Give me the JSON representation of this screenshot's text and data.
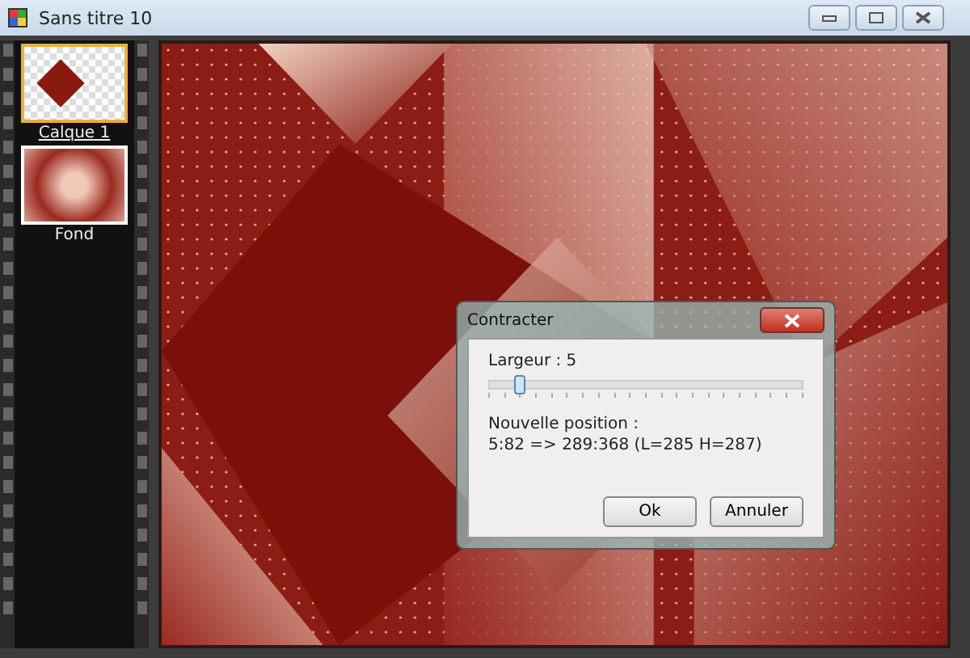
{
  "window": {
    "title": "Sans titre 10"
  },
  "layers": [
    {
      "name": "Calque 1",
      "kind": "shape",
      "selected": true
    },
    {
      "name": "Fond",
      "kind": "pattern",
      "selected": false
    }
  ],
  "dialog": {
    "title": "Contracter",
    "width_label": "Largeur : 5",
    "slider": {
      "level": 0.08
    },
    "position_label": "Nouvelle position :",
    "position_value": "5:82 => 289:368 (L=285  H=287)",
    "buttons": [
      "Ok",
      "Annuler"
    ]
  }
}
